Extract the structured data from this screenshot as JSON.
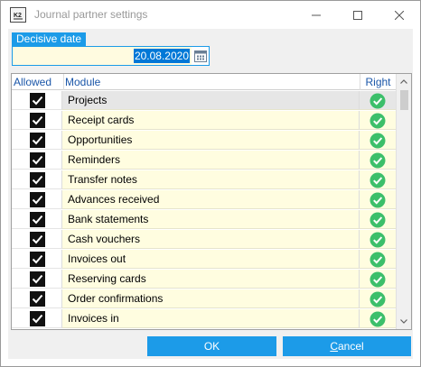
{
  "window": {
    "title": "Journal partner settings"
  },
  "date": {
    "label": "Decisive date",
    "value": "20.08.2020"
  },
  "grid": {
    "columns": {
      "allowed": "Allowed",
      "module": "Module",
      "right": "Right"
    },
    "rows": [
      {
        "module": "Projects",
        "allowed": true,
        "right": true,
        "selected": true
      },
      {
        "module": "Receipt cards",
        "allowed": true,
        "right": true
      },
      {
        "module": "Opportunities",
        "allowed": true,
        "right": true
      },
      {
        "module": "Reminders",
        "allowed": true,
        "right": true
      },
      {
        "module": "Transfer notes",
        "allowed": true,
        "right": true
      },
      {
        "module": "Advances received",
        "allowed": true,
        "right": true
      },
      {
        "module": "Bank statements",
        "allowed": true,
        "right": true
      },
      {
        "module": "Cash vouchers",
        "allowed": true,
        "right": true
      },
      {
        "module": "Invoices out",
        "allowed": true,
        "right": true
      },
      {
        "module": "Reserving cards",
        "allowed": true,
        "right": true
      },
      {
        "module": "Order confirmations",
        "allowed": true,
        "right": true
      },
      {
        "module": "Invoices in",
        "allowed": true,
        "right": true
      }
    ]
  },
  "buttons": {
    "ok": "OK",
    "cancel_first": "C",
    "cancel_rest": "ancel"
  },
  "colors": {
    "accent": "#1c9be8",
    "check_green": "#3cbf6a",
    "cell_yellow": "#fffde0"
  },
  "icons": {
    "app": "app-logo-icon",
    "calendar": "calendar-icon",
    "checkbox": "checkbox-checked-icon",
    "right": "check-circle-icon"
  }
}
